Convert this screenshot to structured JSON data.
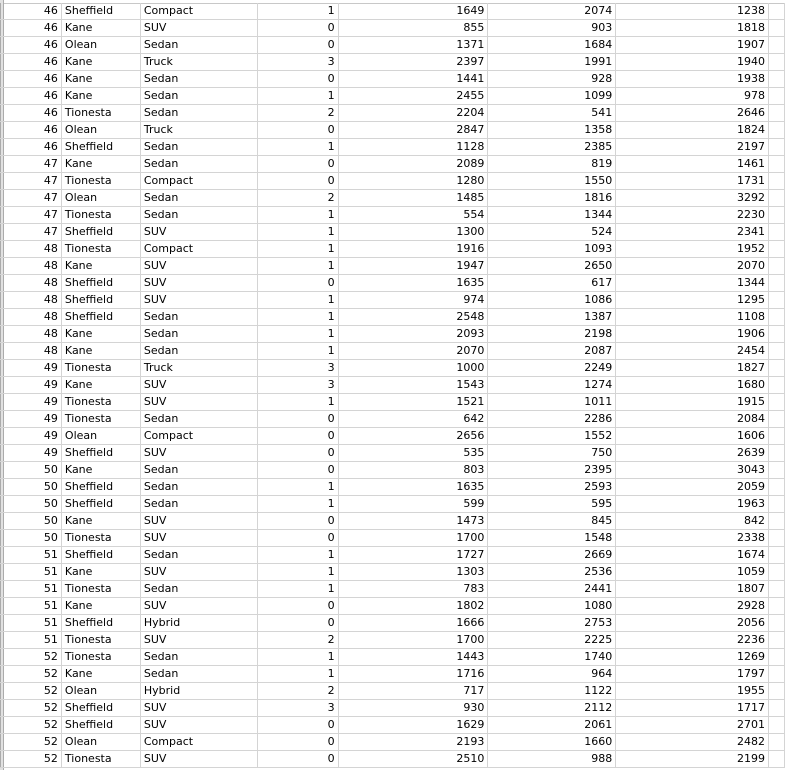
{
  "sheet": {
    "rows": [
      [
        46,
        "Sheffield",
        "Compact",
        1,
        1649,
        2074,
        1238
      ],
      [
        46,
        "Kane",
        "SUV",
        0,
        855,
        903,
        1818
      ],
      [
        46,
        "Olean",
        "Sedan",
        0,
        1371,
        1684,
        1907
      ],
      [
        46,
        "Kane",
        "Truck",
        3,
        2397,
        1991,
        1940
      ],
      [
        46,
        "Kane",
        "Sedan",
        0,
        1441,
        928,
        1938
      ],
      [
        46,
        "Kane",
        "Sedan",
        1,
        2455,
        1099,
        978
      ],
      [
        46,
        "Tionesta",
        "Sedan",
        2,
        2204,
        541,
        2646
      ],
      [
        46,
        "Olean",
        "Truck",
        0,
        2847,
        1358,
        1824
      ],
      [
        46,
        "Sheffield",
        "Sedan",
        1,
        1128,
        2385,
        2197
      ],
      [
        47,
        "Kane",
        "Sedan",
        0,
        2089,
        819,
        1461
      ],
      [
        47,
        "Tionesta",
        "Compact",
        0,
        1280,
        1550,
        1731
      ],
      [
        47,
        "Olean",
        "Sedan",
        2,
        1485,
        1816,
        3292
      ],
      [
        47,
        "Tionesta",
        "Sedan",
        1,
        554,
        1344,
        2230
      ],
      [
        47,
        "Sheffield",
        "SUV",
        1,
        1300,
        524,
        2341
      ],
      [
        48,
        "Tionesta",
        "Compact",
        1,
        1916,
        1093,
        1952
      ],
      [
        48,
        "Kane",
        "SUV",
        1,
        1947,
        2650,
        2070
      ],
      [
        48,
        "Sheffield",
        "SUV",
        0,
        1635,
        617,
        1344
      ],
      [
        48,
        "Sheffield",
        "SUV",
        1,
        974,
        1086,
        1295
      ],
      [
        48,
        "Sheffield",
        "Sedan",
        1,
        2548,
        1387,
        1108
      ],
      [
        48,
        "Kane",
        "Sedan",
        1,
        2093,
        2198,
        1906
      ],
      [
        48,
        "Kane",
        "Sedan",
        1,
        2070,
        2087,
        2454
      ],
      [
        49,
        "Tionesta",
        "Truck",
        3,
        1000,
        2249,
        1827
      ],
      [
        49,
        "Kane",
        "SUV",
        3,
        1543,
        1274,
        1680
      ],
      [
        49,
        "Tionesta",
        "SUV",
        1,
        1521,
        1011,
        1915
      ],
      [
        49,
        "Tionesta",
        "Sedan",
        0,
        642,
        2286,
        2084
      ],
      [
        49,
        "Olean",
        "Compact",
        0,
        2656,
        1552,
        1606
      ],
      [
        49,
        "Sheffield",
        "SUV",
        0,
        535,
        750,
        2639
      ],
      [
        50,
        "Kane",
        "Sedan",
        0,
        803,
        2395,
        3043
      ],
      [
        50,
        "Sheffield",
        "Sedan",
        1,
        1635,
        2593,
        2059
      ],
      [
        50,
        "Sheffield",
        "Sedan",
        1,
        599,
        595,
        1963
      ],
      [
        50,
        "Kane",
        "SUV",
        0,
        1473,
        845,
        842
      ],
      [
        50,
        "Tionesta",
        "SUV",
        0,
        1700,
        1548,
        2338
      ],
      [
        51,
        "Sheffield",
        "Sedan",
        1,
        1727,
        2669,
        1674
      ],
      [
        51,
        "Kane",
        "SUV",
        1,
        1303,
        2536,
        1059
      ],
      [
        51,
        "Tionesta",
        "Sedan",
        1,
        783,
        2441,
        1807
      ],
      [
        51,
        "Kane",
        "SUV",
        0,
        1802,
        1080,
        2928
      ],
      [
        51,
        "Sheffield",
        "Hybrid",
        0,
        1666,
        2753,
        2056
      ],
      [
        51,
        "Tionesta",
        "SUV",
        2,
        1700,
        2225,
        2236
      ],
      [
        52,
        "Tionesta",
        "Sedan",
        1,
        1443,
        1740,
        1269
      ],
      [
        52,
        "Kane",
        "Sedan",
        1,
        1716,
        964,
        1797
      ],
      [
        52,
        "Olean",
        "Hybrid",
        2,
        717,
        1122,
        1955
      ],
      [
        52,
        "Sheffield",
        "SUV",
        3,
        930,
        2112,
        1717
      ],
      [
        52,
        "Sheffield",
        "SUV",
        0,
        1629,
        2061,
        2701
      ],
      [
        52,
        "Olean",
        "Compact",
        0,
        2193,
        1660,
        2482
      ],
      [
        52,
        "Tionesta",
        "SUV",
        0,
        2510,
        988,
        2199
      ]
    ]
  }
}
